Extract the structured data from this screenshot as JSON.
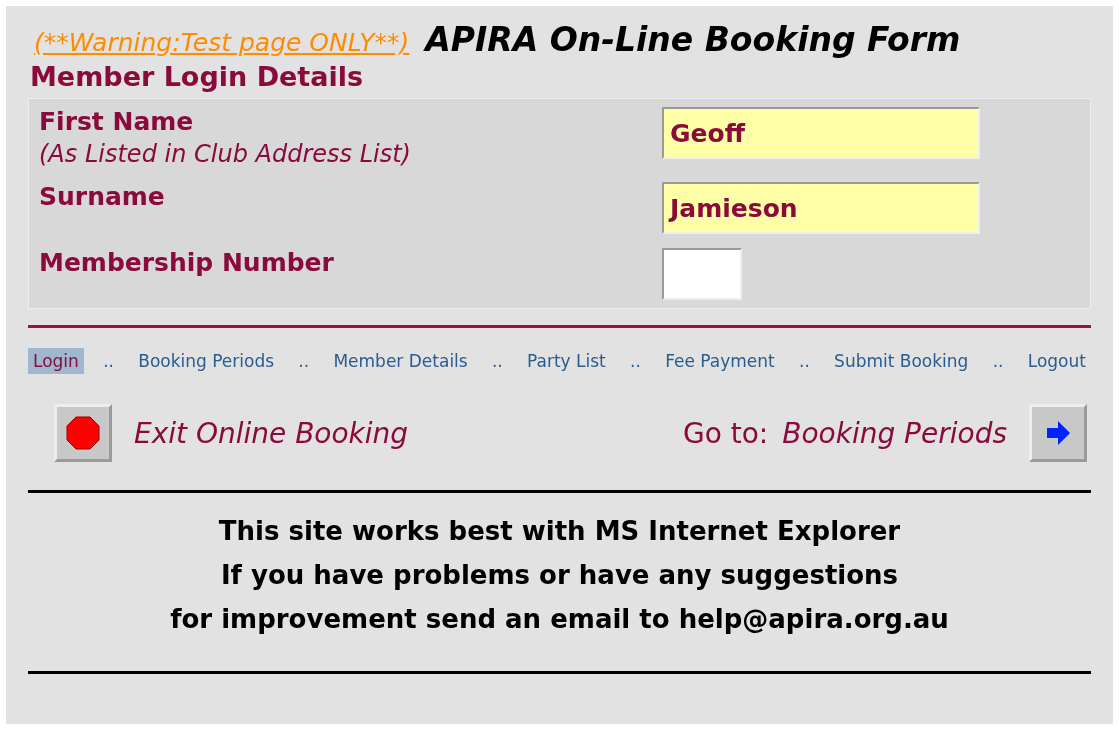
{
  "header": {
    "warning": "(**Warning:Test page ONLY**)",
    "title": "APIRA On-Line Booking Form"
  },
  "section_title": "Member Login Details",
  "fields": [
    {
      "label": "First Name",
      "note": "(As Listed in Club Address List)",
      "value": "Geoff",
      "kind": "wide"
    },
    {
      "label": "Surname",
      "value": "Jamieson",
      "kind": "wide"
    },
    {
      "label": "Membership Number",
      "kind": "short"
    }
  ],
  "nav": [
    {
      "label": "Login",
      "selected": true
    },
    {
      "separator": "..",
      "label": "Booking Periods",
      "selected": false
    },
    {
      "separator": "..",
      "label": "Member Details",
      "selected": false
    },
    {
      "separator": "..",
      "label": "Party List",
      "selected": false
    },
    {
      "separator": "..",
      "label": "Fee Payment",
      "selected": false
    },
    {
      "separator": "..",
      "label": "Submit Booking",
      "selected": false
    },
    {
      "separator": "..",
      "label": "Logout",
      "selected": false
    }
  ],
  "exit": {
    "label": "Exit Online Booking"
  },
  "next": {
    "prefix": "Go to:",
    "label": "Booking Periods"
  },
  "footer": [
    "This site works best with MS Internet Explorer",
    "If you have problems or have any suggestions",
    "for improvement send an email to help@apira.org.au"
  ]
}
